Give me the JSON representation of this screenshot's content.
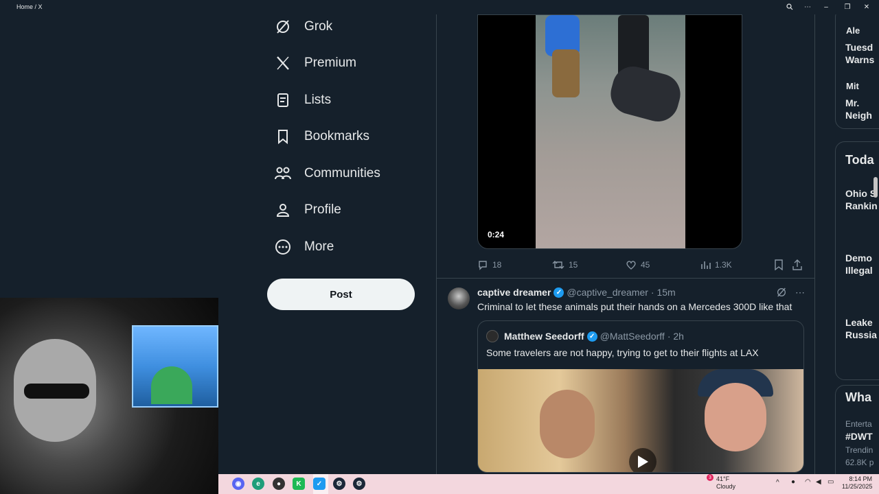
{
  "window": {
    "title": "Home / X"
  },
  "nav": {
    "items": [
      {
        "label": "Grok",
        "icon": "grok-icon"
      },
      {
        "label": "Premium",
        "icon": "x-logo-icon"
      },
      {
        "label": "Lists",
        "icon": "list-icon"
      },
      {
        "label": "Bookmarks",
        "icon": "bookmark-icon"
      },
      {
        "label": "Communities",
        "icon": "communities-icon"
      },
      {
        "label": "Profile",
        "icon": "profile-icon"
      },
      {
        "label": "More",
        "icon": "more-circle-icon"
      }
    ],
    "post_label": "Post"
  },
  "tweet1": {
    "video_duration": "0:24",
    "replies": "18",
    "reposts": "15",
    "likes": "45",
    "views": "1.3K"
  },
  "tweet2": {
    "name": "captive dreamer",
    "handle": "@captive_dreamer",
    "time": "· 15m",
    "text": "Criminal to let these animals put their hands on a Mercedes 300D like that",
    "quote": {
      "name": "Matthew Seedorff",
      "handle": "@MattSeedorff",
      "time": "· 2h",
      "text": "Some travelers are not happy, trying to get to their flights at LAX"
    }
  },
  "right_sidebar": {
    "box1": {
      "line1": "Ale",
      "line2": "Tuesd",
      "line3": "Warns",
      "line4": "Mit",
      "line5": "Mr.",
      "line6": "Neigh"
    },
    "box2": {
      "title": "Toda",
      "items": [
        {
          "l1": "Ohio S",
          "l2": "Rankin"
        },
        {
          "l1": "Demo",
          "l2": "Illegal"
        },
        {
          "l1": "Leake",
          "l2": "Russia"
        }
      ]
    },
    "box3": {
      "title": "Wha",
      "l1": "Enterta",
      "l2": "#DWT",
      "l3": "Trendin",
      "l4": "62.8K p"
    }
  },
  "taskbar": {
    "weather_temp": "41°F",
    "weather_desc": "Cloudy",
    "weather_badge": "3",
    "time": "8:14 PM",
    "date": "11/25/2025"
  },
  "colors": {
    "bg": "#15202b",
    "accent": "#1d9bf0",
    "border": "#38444d",
    "muted": "#8b98a5"
  }
}
